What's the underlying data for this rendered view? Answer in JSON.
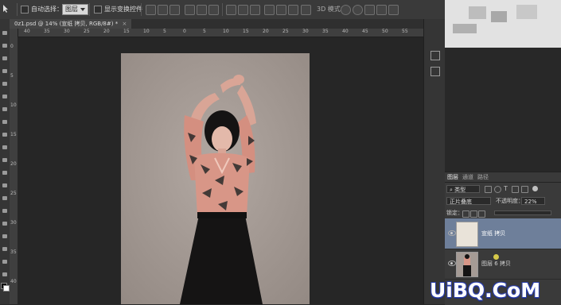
{
  "options_bar": {
    "auto_select_label": "自动选择：",
    "auto_select_value": "图层",
    "show_transform_label": "显示变换控件",
    "mode_3d_label": "3D 模式："
  },
  "document": {
    "tab_title": "0z1.psd @ 14% (宣纸 拷贝, RGB/8#) *",
    "ruler_h": [
      "40",
      "35",
      "30",
      "25",
      "20",
      "15",
      "10",
      "5",
      "0",
      "5",
      "10",
      "15",
      "20",
      "25",
      "30",
      "35",
      "40",
      "45",
      "50",
      "55"
    ],
    "ruler_v": [
      "0",
      "5",
      "10",
      "15",
      "20",
      "25",
      "30",
      "35",
      "40"
    ]
  },
  "right_panel": {
    "tabs": [
      "图层",
      "通道",
      "路径"
    ],
    "filter_kind": "类型",
    "blend_mode": "正片叠底",
    "opacity_label": "不透明度：",
    "opacity_value": "22%",
    "lock_label": "锁定：",
    "fill_label": "填充：",
    "layers": [
      {
        "name": "宣纸 拷贝",
        "selected": true
      },
      {
        "name": "图层 6 拷贝",
        "selected": false
      }
    ]
  },
  "watermark": "UiBQ.CoM",
  "colors": {
    "accent_selected_layer": "#6e7f9a",
    "canvas_bg": "#262626",
    "photo_bg": "#a59b95"
  }
}
